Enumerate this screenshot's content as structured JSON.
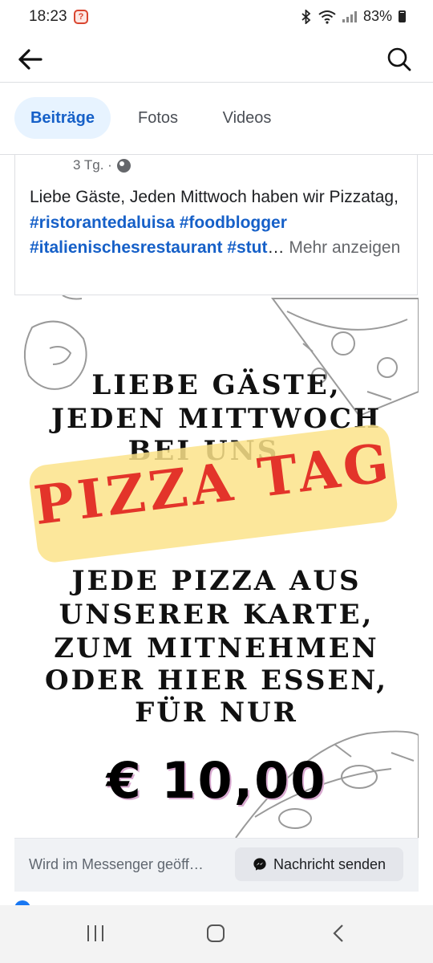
{
  "status_bar": {
    "time": "18:23",
    "battery": "83%",
    "icons": [
      "bluetooth-icon",
      "wifi-icon",
      "signal-icon",
      "battery-icon"
    ]
  },
  "nav": {
    "back_icon": "back-arrow-icon",
    "search_icon": "search-icon"
  },
  "tabs": [
    {
      "label": "Beiträge",
      "active": true
    },
    {
      "label": "Fotos",
      "active": false
    },
    {
      "label": "Videos",
      "active": false
    }
  ],
  "post": {
    "time_ago": "3 Tg. ·",
    "text_plain": "Liebe Gäste, Jeden Mittwoch haben wir Pizzatag, ",
    "hashtags": [
      "#ristorantedaluisa",
      "#foodblogger",
      "#italienischesrestaurant",
      "#stut"
    ],
    "ellipsis": "…",
    "more_label": "Mehr anzeigen"
  },
  "poster": {
    "line1": "LIEBE GÄSTE,",
    "line2": "JEDEN MITTWOCH",
    "line3": "BEI UNS",
    "highlight": "PIZZA TAG",
    "line4": "JEDE PIZZA AUS",
    "line5": "UNSERER KARTE,",
    "line6": "ZUM MITNEHMEN",
    "line7": "ODER HIER ESSEN,",
    "line8": "FÜR NUR",
    "price": "€ 10,00",
    "colors": {
      "highlight_bg": "#fbe38a",
      "highlight_text": "#e3342a"
    }
  },
  "messenger": {
    "hint": "Wird im Messenger geöff…",
    "button_label": "Nachricht senden"
  },
  "system_nav": {
    "icons": [
      "recent-apps-icon",
      "home-icon",
      "back-icon"
    ]
  }
}
